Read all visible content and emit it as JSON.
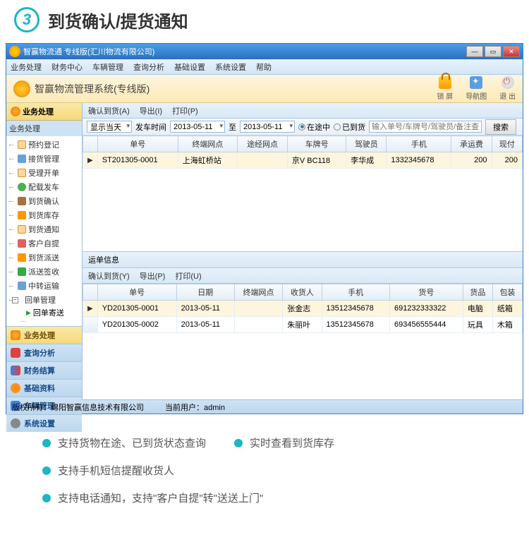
{
  "header": {
    "number": "3",
    "title": "到货确认/提货通知"
  },
  "window": {
    "title": "智赢物流通 专线版(汇川物流有限公司)",
    "menu": [
      "业务处理",
      "财务中心",
      "车辆管理",
      "查询分析",
      "基础设置",
      "系统设置",
      "帮助"
    ],
    "brand": "智赢物流管理系统(专线版)",
    "tools": {
      "lock": "锁 屏",
      "nav": "导航图",
      "exit": "退 出"
    }
  },
  "sidebar": {
    "header": "业务处理",
    "label": "业务处理",
    "tree": [
      "预约登记",
      "接货管理",
      "受理开单",
      "配载发车",
      "到货确认",
      "到货库存",
      "到货通知",
      "客户自提",
      "到货派送",
      "派送签收",
      "中转运输"
    ],
    "expand": "回单管理",
    "sub": "回单寄送",
    "nav": [
      {
        "label": "业务处理",
        "active": true
      },
      {
        "label": "查询分析",
        "active": false
      },
      {
        "label": "财务结算",
        "active": false
      },
      {
        "label": "基础资料",
        "active": false
      },
      {
        "label": "车辆管理",
        "active": false
      },
      {
        "label": "系统设置",
        "active": false
      }
    ]
  },
  "toolbar1": {
    "confirm": "确认到货(A)",
    "export": "导出(I)",
    "print": "打印(P)"
  },
  "filter": {
    "show_today": "显示当天",
    "depart_label": "发车时间",
    "date_from": "2013-05-11",
    "to": "至",
    "date_to": "2013-05-11",
    "in_transit": "在途中",
    "arrived": "已到货",
    "search_placeholder": "输入单号/车牌号/驾驶员/备注查询",
    "search_btn": "搜索"
  },
  "grid1": {
    "cols": [
      "单号",
      "终端网点",
      "途经网点",
      "车牌号",
      "驾驶员",
      "手机",
      "承运费",
      "现付"
    ],
    "row": {
      "no": "ST201305-0001",
      "terminal": "上海虹桥站",
      "via": "",
      "plate": "京V BC118",
      "driver": "李华成",
      "phone": "1332345678",
      "fee": "200",
      "pay": "200"
    }
  },
  "section2": "运单信息",
  "toolbar2": {
    "confirm": "确认到货(Y)",
    "export": "导出(P)",
    "print": "打印(U)"
  },
  "grid2": {
    "cols": [
      "单号",
      "日期",
      "终端网点",
      "收货人",
      "手机",
      "货号",
      "货品",
      "包装"
    ],
    "rows": [
      {
        "no": "YD201305-0001",
        "date": "2013-05-11",
        "terminal": "",
        "recv": "张金志",
        "phone": "13512345678",
        "cargo_no": "691232333322",
        "goods": "电脑",
        "pack": "纸箱"
      },
      {
        "no": "YD201305-0002",
        "date": "2013-05-11",
        "terminal": "",
        "recv": "朱丽叶",
        "phone": "13512345678",
        "cargo_no": "693456555444",
        "goods": "玩具",
        "pack": "木箱"
      }
    ]
  },
  "status": {
    "copyright": "版权所有：绵阳智赢信息技术有限公司",
    "user_label": "当前用户：",
    "user": "admin"
  },
  "bullets": {
    "r1a": "支持货物在途、已到货状态查询",
    "r1b": "实时查看到货库存",
    "r2": "支持手机短信提醒收货人",
    "r3": "支持电话通知，支持\"客户自提\"转\"送送上门\""
  }
}
